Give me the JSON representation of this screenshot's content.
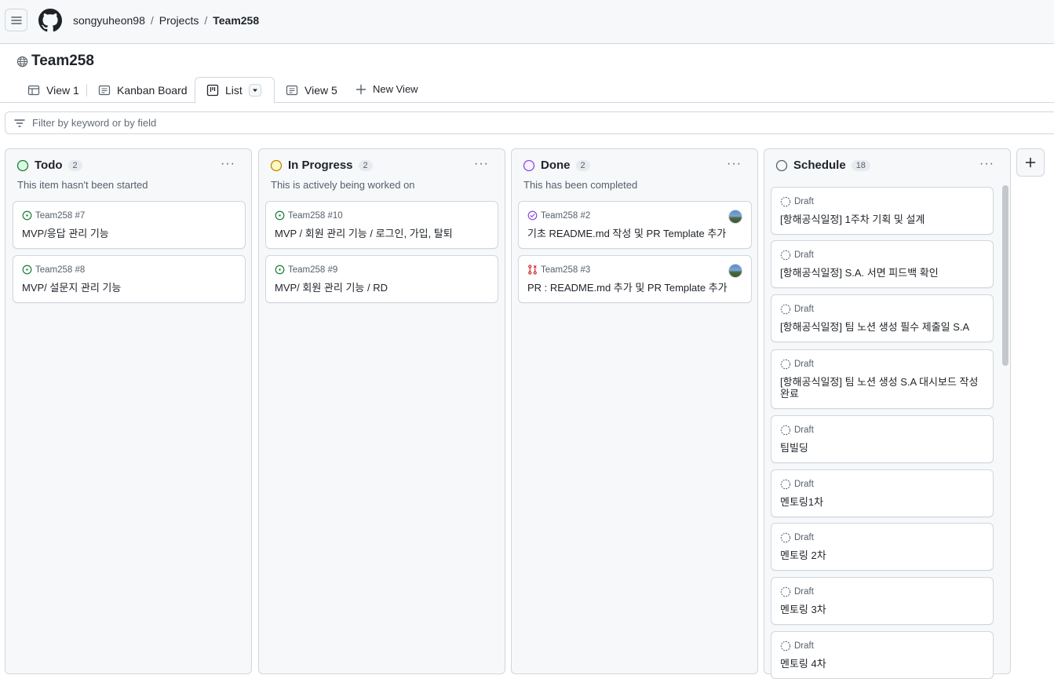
{
  "breadcrumb": {
    "owner": "songyuheon98",
    "section": "Projects",
    "project": "Team258",
    "sep": "/"
  },
  "project_title": "Team258",
  "tabs": [
    {
      "label": "View 1"
    },
    {
      "label": "Kanban Board"
    },
    {
      "label": "List"
    },
    {
      "label": "View 5"
    },
    {
      "label": "New View"
    }
  ],
  "filter": {
    "placeholder": "Filter by keyword or by field"
  },
  "columns": [
    {
      "name": "Todo",
      "count": "2",
      "desc": "This item hasn't been started",
      "color": "#1a7f37",
      "cards": [
        {
          "meta": "Team258 #7",
          "title": "MVP/응답 관리 기능"
        },
        {
          "meta": "Team258 #8",
          "title": "MVP/ 설문지 관리 기능"
        }
      ]
    },
    {
      "name": "In Progress",
      "count": "2",
      "desc": "This is actively being worked on",
      "color": "#bf8700",
      "cards": [
        {
          "meta": "Team258 #10",
          "title": "MVP / 회원 관리 기능 / 로그인, 가입, 탈퇴"
        },
        {
          "meta": "Team258 #9",
          "title": "MVP/ 회원 관리 기능 / RD"
        }
      ]
    },
    {
      "name": "Done",
      "count": "2",
      "desc": "This has been completed",
      "color": "#8250df",
      "cards": [
        {
          "meta": "Team258 #2",
          "title": "기초 README.md 작성 및 PR Template 추가"
        },
        {
          "meta": "Team258 #3",
          "title": "PR : README.md 추가 및 PR Template 추가"
        }
      ]
    },
    {
      "name": "Schedule",
      "count": "18",
      "desc": "",
      "cards": [
        {
          "meta": "Draft",
          "title": "[항해공식일정] 1주차 기획 및 설계"
        },
        {
          "meta": "Draft",
          "title": "[항해공식일정] S.A. 서면 피드백 확인"
        },
        {
          "meta": "Draft",
          "title": "[항해공식일정] 팀 노션 생성 필수 제출일 S.A"
        },
        {
          "meta": "Draft",
          "title": "[항해공식일정] 팀 노션 생성 S.A 대시보드 작성 완료"
        },
        {
          "meta": "Draft",
          "title": "팀빌딩"
        },
        {
          "meta": "Draft",
          "title": "멘토링1차"
        },
        {
          "meta": "Draft",
          "title": "멘토링 2차"
        },
        {
          "meta": "Draft",
          "title": "멘토링 3차"
        },
        {
          "meta": "Draft",
          "title": "멘토링 4차"
        }
      ]
    }
  ],
  "icons": {
    "open_issue_color": "#1a7f37",
    "closed_issue_color": "#8250df",
    "pr_closed_color": "#cf222e"
  }
}
